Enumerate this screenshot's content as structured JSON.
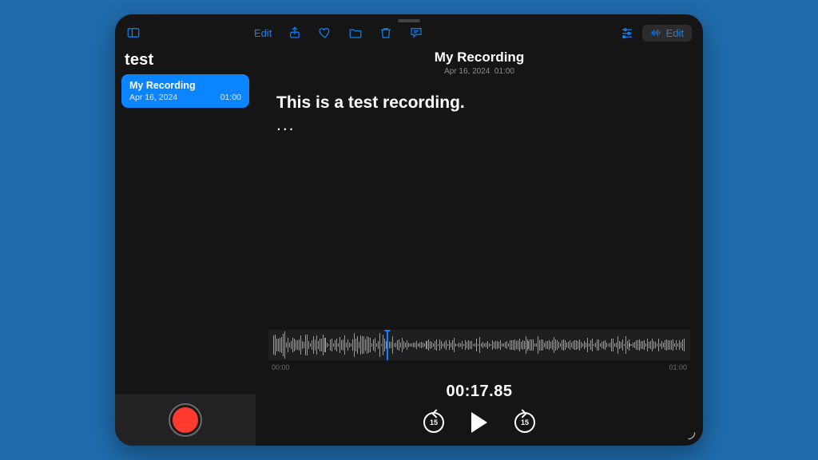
{
  "toolbar": {
    "edit_left": "Edit",
    "edit_right": "Edit"
  },
  "sidebar": {
    "title": "test",
    "items": [
      {
        "name": "My Recording",
        "date": "Apr 16, 2024",
        "duration": "01:00"
      }
    ]
  },
  "main": {
    "title": "My Recording",
    "sub_date": "Apr 16, 2024",
    "sub_dur": "01:00",
    "transcript": "This is a test recording.",
    "dots": "..."
  },
  "wave": {
    "start": "00:00",
    "end": "01:00"
  },
  "timecode": "00:17.85",
  "skip": {
    "back": "15",
    "fwd": "15"
  }
}
